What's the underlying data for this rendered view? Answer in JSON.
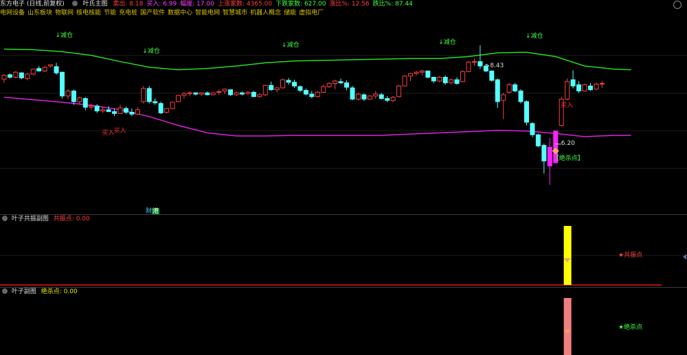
{
  "header": {
    "stock": "东方电子 (日线,前复权)",
    "indicator": "叶氏主图",
    "items": [
      {
        "label": "卖出:",
        "value": "8.18",
        "color": "#ff4040"
      },
      {
        "label": "买入:",
        "value": "6.99",
        "color": "#ff40ff"
      },
      {
        "label": "幅度:",
        "value": "17.00",
        "color": "#ff40ff"
      },
      {
        "label": "上涨家数:",
        "value": "4365.00",
        "color": "#ff4040"
      },
      {
        "label": "下跌家数:",
        "value": "627.00",
        "color": "#40ff40"
      },
      {
        "label": "涨比%:",
        "value": "12.56",
        "color": "#ff4040"
      },
      {
        "label": "跌比%:",
        "value": "87.44",
        "color": "#40ff40"
      }
    ]
  },
  "concepts": [
    "电网设备",
    "山东板块",
    "物联网",
    "核电核能",
    "节能",
    "充电桩",
    "国产软件",
    "数据中心",
    "智能电网",
    "智慧城市",
    "机器人概念",
    "储能",
    "虚拟电厂"
  ],
  "annotations": {
    "reduce": "↓减仓",
    "buy": "买入",
    "high_price": "8.43",
    "low_price": "6.20",
    "kill_point_box": "【绝杀点】",
    "news_badge": [
      "财",
      "港"
    ]
  },
  "panel2": {
    "title": "叶子共振副图",
    "label": "共振点:",
    "value": "0.00",
    "marker": "★共振点"
  },
  "panel3": {
    "title": "叶子副图",
    "label": "绝杀点:",
    "value": "0.00",
    "marker": "★绝杀点"
  },
  "colors": {
    "up": "#ff4040",
    "down": "#54ffff",
    "upper_band": "#22dd22",
    "lower_band": "#e020e0",
    "resonance_bar": "#ffff00",
    "kill_bar": "#f08080"
  },
  "chart_data": {
    "type": "candlestick",
    "candles": [
      [
        7.89,
        7.97,
        7.83,
        7.95
      ],
      [
        7.96,
        7.98,
        7.9,
        7.92
      ],
      [
        7.92,
        8.02,
        7.9,
        8.0
      ],
      [
        7.99,
        8.0,
        7.89,
        7.91
      ],
      [
        7.9,
        7.99,
        7.87,
        7.97
      ],
      [
        7.97,
        8.05,
        7.95,
        8.05
      ],
      [
        8.06,
        8.1,
        8.01,
        8.02
      ],
      [
        8.02,
        8.1,
        8.0,
        8.08
      ],
      [
        8.1,
        8.12,
        8.07,
        8.12
      ],
      [
        8.09,
        8.15,
        7.96,
        7.99
      ],
      [
        8.0,
        8.01,
        7.58,
        7.62
      ],
      [
        7.62,
        7.73,
        7.57,
        7.7
      ],
      [
        7.7,
        7.72,
        7.48,
        7.53
      ],
      [
        7.53,
        7.61,
        7.48,
        7.59
      ],
      [
        7.58,
        7.6,
        7.39,
        7.44
      ],
      [
        7.44,
        7.5,
        7.4,
        7.46
      ],
      [
        7.46,
        7.49,
        7.35,
        7.38
      ],
      [
        7.38,
        7.44,
        7.35,
        7.4
      ],
      [
        7.4,
        7.46,
        7.36,
        7.37
      ],
      [
        7.37,
        7.42,
        7.3,
        7.34
      ],
      [
        7.34,
        7.48,
        7.33,
        7.43
      ],
      [
        7.42,
        7.45,
        7.33,
        7.36
      ],
      [
        7.36,
        7.42,
        7.3,
        7.33
      ],
      [
        7.33,
        7.44,
        7.32,
        7.4
      ],
      [
        7.53,
        7.78,
        7.5,
        7.74
      ],
      [
        7.74,
        7.78,
        7.5,
        7.53
      ],
      [
        7.53,
        7.58,
        7.48,
        7.51
      ],
      [
        7.5,
        7.53,
        7.33,
        7.35
      ],
      [
        7.36,
        7.43,
        7.34,
        7.42
      ],
      [
        7.42,
        7.53,
        7.41,
        7.52
      ],
      [
        7.53,
        7.64,
        7.52,
        7.63
      ],
      [
        7.63,
        7.68,
        7.58,
        7.66
      ],
      [
        7.66,
        7.69,
        7.62,
        7.67
      ],
      [
        7.67,
        7.68,
        7.63,
        7.65
      ],
      [
        7.65,
        7.68,
        7.62,
        7.67
      ],
      [
        7.67,
        7.69,
        7.63,
        7.64
      ],
      [
        7.64,
        7.68,
        7.63,
        7.67
      ],
      [
        7.68,
        7.72,
        7.64,
        7.69
      ],
      [
        7.7,
        7.74,
        7.65,
        7.73
      ],
      [
        7.72,
        7.72,
        7.62,
        7.64
      ],
      [
        7.64,
        7.69,
        7.62,
        7.67
      ],
      [
        7.67,
        7.69,
        7.63,
        7.65
      ],
      [
        7.66,
        7.7,
        7.63,
        7.68
      ],
      [
        7.68,
        7.7,
        7.6,
        7.61
      ],
      [
        7.61,
        7.66,
        7.59,
        7.64
      ],
      [
        7.64,
        7.8,
        7.62,
        7.79
      ],
      [
        7.79,
        7.85,
        7.7,
        7.72
      ],
      [
        7.72,
        7.76,
        7.68,
        7.75
      ],
      [
        7.75,
        7.9,
        7.74,
        7.88
      ],
      [
        7.87,
        7.91,
        7.8,
        7.84
      ],
      [
        7.84,
        7.88,
        7.75,
        7.78
      ],
      [
        7.77,
        7.79,
        7.68,
        7.71
      ],
      [
        7.71,
        7.74,
        7.63,
        7.65
      ],
      [
        7.65,
        7.7,
        7.58,
        7.61
      ],
      [
        7.61,
        7.7,
        7.6,
        7.68
      ],
      [
        7.68,
        7.8,
        7.67,
        7.77
      ],
      [
        7.77,
        7.84,
        7.75,
        7.82
      ],
      [
        7.82,
        7.88,
        7.73,
        7.86
      ],
      [
        7.85,
        7.9,
        7.81,
        7.83
      ],
      [
        7.83,
        7.87,
        7.71,
        7.76
      ],
      [
        7.75,
        7.78,
        7.55,
        7.57
      ],
      [
        7.57,
        7.67,
        7.55,
        7.65
      ],
      [
        7.64,
        7.66,
        7.54,
        7.57
      ],
      [
        7.57,
        7.63,
        7.56,
        7.62
      ],
      [
        7.62,
        7.7,
        7.58,
        7.65
      ],
      [
        7.64,
        7.67,
        7.56,
        7.58
      ],
      [
        7.58,
        7.62,
        7.52,
        7.55
      ],
      [
        7.55,
        7.62,
        7.52,
        7.6
      ],
      [
        7.61,
        7.8,
        7.6,
        7.78
      ],
      [
        7.78,
        7.95,
        7.77,
        7.94
      ],
      [
        7.94,
        7.99,
        7.86,
        7.98
      ],
      [
        7.98,
        8.02,
        7.95,
        8.0
      ],
      [
        8.0,
        8.04,
        7.95,
        8.02
      ],
      [
        8.02,
        8.03,
        7.9,
        7.92
      ],
      [
        7.92,
        7.93,
        7.83,
        7.86
      ],
      [
        7.86,
        7.94,
        7.84,
        7.92
      ],
      [
        7.92,
        7.95,
        7.8,
        7.83
      ],
      [
        7.83,
        7.9,
        7.81,
        7.88
      ],
      [
        7.88,
        7.92,
        7.8,
        7.82
      ],
      [
        7.85,
        8.03,
        7.84,
        8.01
      ],
      [
        8.01,
        8.18,
        8.0,
        8.16
      ],
      [
        8.16,
        8.22,
        8.1,
        8.17
      ],
      [
        8.17,
        8.43,
        8.05,
        8.1
      ],
      [
        8.1,
        8.13,
        8.0,
        8.02
      ],
      [
        8.02,
        8.03,
        7.85,
        7.87
      ],
      [
        7.88,
        7.9,
        7.43,
        7.53
      ],
      [
        7.55,
        7.67,
        7.25,
        7.64
      ],
      [
        7.68,
        7.83,
        7.66,
        7.8
      ],
      [
        7.8,
        7.83,
        7.68,
        7.7
      ],
      [
        7.7,
        7.73,
        7.5,
        7.53
      ],
      [
        7.53,
        7.55,
        7.15,
        7.2
      ],
      [
        7.18,
        7.2,
        6.96,
        7.0
      ],
      [
        7.0,
        7.02,
        6.8,
        6.82
      ],
      [
        6.83,
        6.86,
        6.38,
        6.58
      ],
      [
        6.8,
        6.95,
        6.2,
        6.5
      ],
      [
        6.55,
        6.56,
        6.85,
        7.06
      ],
      [
        7.15,
        7.6,
        7.13,
        7.57
      ],
      [
        7.57,
        7.9,
        7.55,
        7.85
      ],
      [
        7.88,
        8.03,
        7.74,
        7.78
      ],
      [
        7.8,
        7.86,
        7.67,
        7.7
      ],
      [
        7.7,
        7.82,
        7.69,
        7.8
      ],
      [
        7.78,
        7.83,
        7.7,
        7.72
      ],
      [
        7.73,
        7.84,
        7.71,
        7.81
      ],
      [
        7.81,
        7.86,
        7.75,
        7.82
      ]
    ],
    "upper_band": [
      [
        0,
        8.37
      ],
      [
        5,
        8.36
      ],
      [
        10,
        8.33
      ],
      [
        15,
        8.27
      ],
      [
        20,
        8.17
      ],
      [
        25,
        8.08
      ],
      [
        30,
        8.04
      ],
      [
        35,
        8.06
      ],
      [
        40,
        8.1
      ],
      [
        45,
        8.15
      ],
      [
        50,
        8.18
      ],
      [
        55,
        8.19
      ],
      [
        60,
        8.2
      ],
      [
        65,
        8.21
      ],
      [
        70,
        8.22
      ],
      [
        75,
        8.22
      ],
      [
        80,
        8.25
      ],
      [
        85,
        8.31
      ],
      [
        90,
        8.32
      ],
      [
        95,
        8.25
      ],
      [
        100,
        8.1
      ],
      [
        105,
        8.05
      ],
      [
        108,
        8.04
      ]
    ],
    "lower_band": [
      [
        0,
        7.6
      ],
      [
        5,
        7.56
      ],
      [
        10,
        7.52
      ],
      [
        15,
        7.47
      ],
      [
        20,
        7.4
      ],
      [
        25,
        7.29
      ],
      [
        30,
        7.15
      ],
      [
        35,
        7.03
      ],
      [
        40,
        6.98
      ],
      [
        45,
        6.98
      ],
      [
        50,
        6.99
      ],
      [
        55,
        6.99
      ],
      [
        60,
        6.99
      ],
      [
        65,
        6.99
      ],
      [
        70,
        7.01
      ],
      [
        75,
        7.03
      ],
      [
        80,
        7.05
      ],
      [
        85,
        7.07
      ],
      [
        90,
        7.06
      ],
      [
        95,
        7.02
      ],
      [
        100,
        6.97
      ],
      [
        105,
        6.99
      ],
      [
        108,
        6.99
      ]
    ],
    "ylim": [
      5.86,
      8.87
    ],
    "reduce_signals": [
      10,
      25,
      49,
      76,
      91
    ],
    "buy_signals": [
      19,
      21,
      98
    ],
    "high_index": 83,
    "low_index": 95,
    "resonance_bar_index": 97,
    "kill_bar_index": 97
  }
}
